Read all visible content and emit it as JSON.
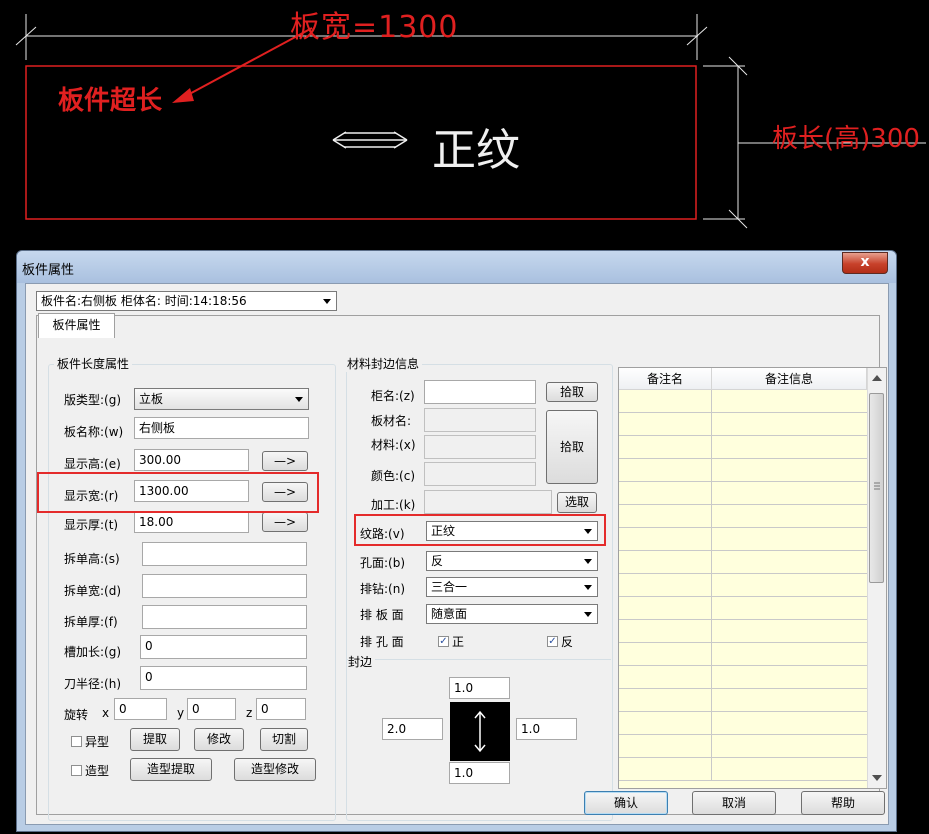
{
  "cad": {
    "width_label": "板宽=1300",
    "over_label": "板件超长",
    "grain_label": "正纹",
    "length_label": "板长(高)300"
  },
  "dialog": {
    "title": "板件属性",
    "close_glyph": "x",
    "panel_select": "板件名:右侧板 柜体名: 时间:14:18:56",
    "tab": "板件属性",
    "length_group": {
      "title": "板件长度属性",
      "type_label": "版类型:(g)",
      "type_value": "立板",
      "name_label": "板名称:(w)",
      "name_value": "右侧板",
      "height_label": "显示高:(e)",
      "height_value": "300.00",
      "width_label": "显示宽:(r)",
      "width_value": "1300.00",
      "thick_label": "显示厚:(t)",
      "thick_value": "18.00",
      "arrow_label": "—>",
      "split_h_label": "拆单高:(s)",
      "split_w_label": "拆单宽:(d)",
      "split_t_label": "拆单厚:(f)",
      "groove_label": "槽加长:(g)",
      "groove_value": "0",
      "radius_label": "刀半径:(h)",
      "radius_value": "0",
      "rotate_label": "旋转",
      "x_label": "x",
      "x_value": "0",
      "y_label": "y",
      "y_value": "0",
      "z_label": "z",
      "z_value": "0",
      "shaped_label": "异型",
      "extract_btn": "提取",
      "modify_btn": "修改",
      "cut_btn": "切割",
      "model_label": "造型",
      "model_extract_btn": "造型提取",
      "model_modify_btn": "造型修改"
    },
    "material_group": {
      "title": "材料封边信息",
      "cabinet_label": "柜名:(z)",
      "pick_btn": "拾取",
      "board_material_label": "板材名:",
      "material_label": "材料:(x)",
      "pick_btn2": "拾取",
      "color_label": "颜色:(c)",
      "process_label": "加工:(k)",
      "select_btn": "选取",
      "grain_label": "纹路:(v)",
      "grain_value": "正纹",
      "hole_face_label": "孔面:(b)",
      "hole_face_value": "反",
      "drill_label": "排钻:(n)",
      "drill_value": "三合一",
      "board_face_label": "排 板 面",
      "board_face_value": "随意面",
      "hole_side_label": "排 孔 面",
      "front_label": "正",
      "back_label": "反",
      "edge_label": "封边",
      "edge_top": "1.0",
      "edge_left": "2.0",
      "edge_right": "1.0",
      "edge_bottom": "1.0"
    },
    "grid": {
      "col1": "备注名",
      "col2": "备注信息"
    },
    "ok_btn": "确认",
    "cancel_btn": "取消",
    "help_btn": "帮助"
  }
}
